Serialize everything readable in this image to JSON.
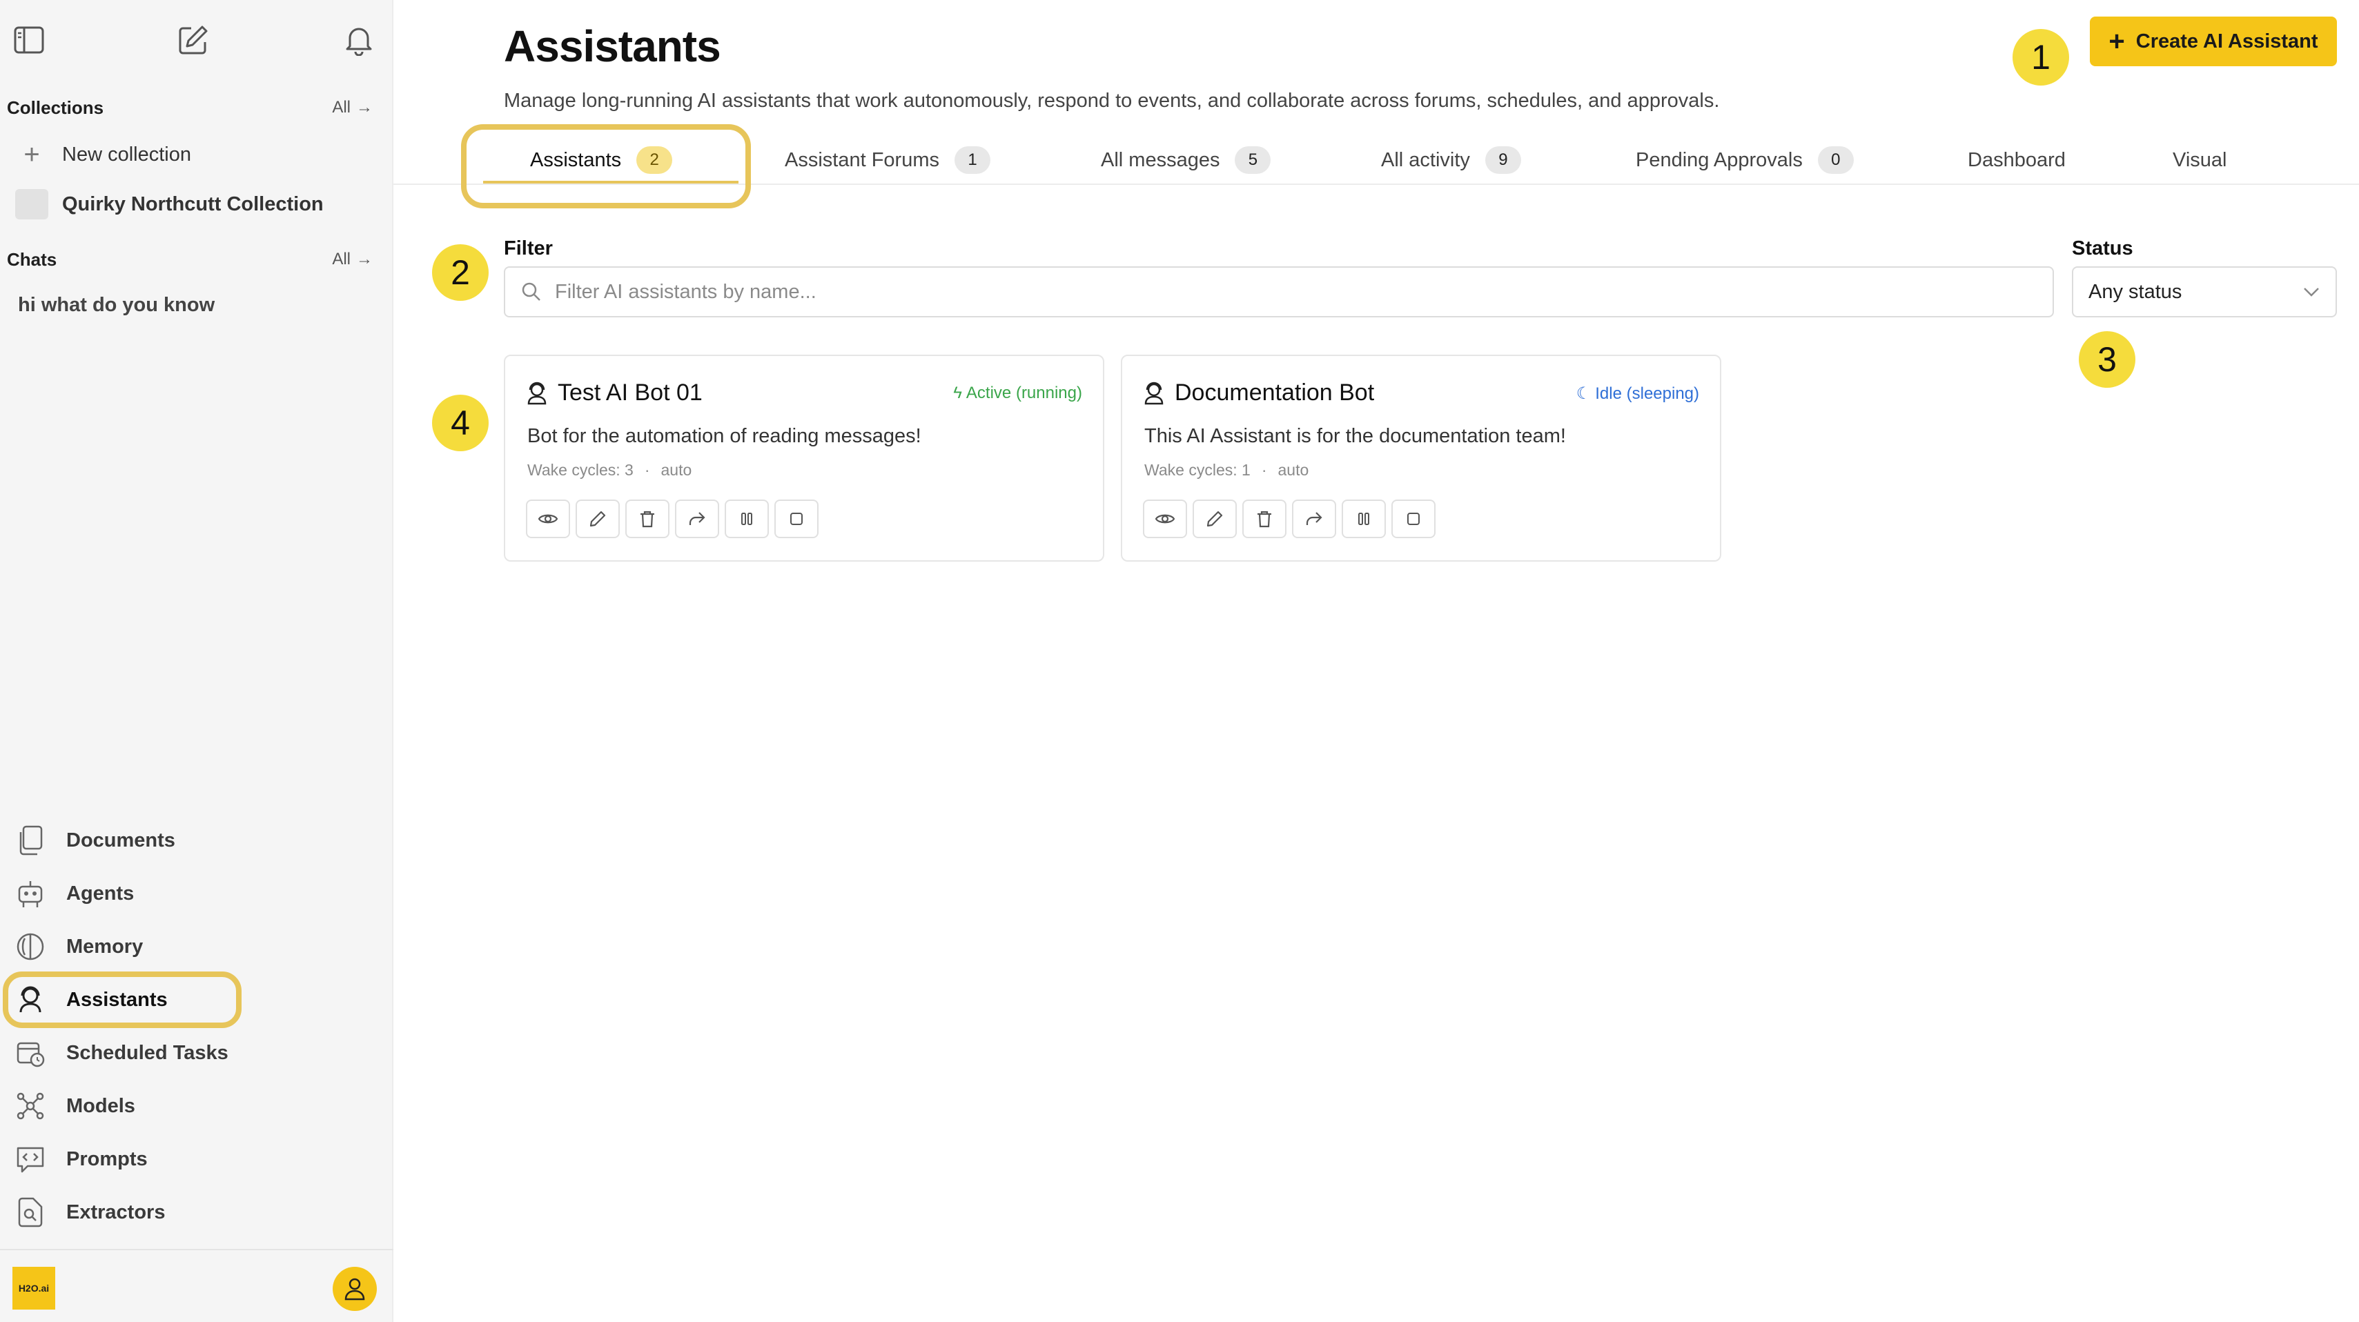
{
  "sidebar": {
    "collections_title": "Collections",
    "collections_all": "All",
    "new_collection": "New collection",
    "collection_item": "Quirky Northcutt Collection",
    "chats_title": "Chats",
    "chats_all": "All",
    "chat_item": "hi what do you know",
    "nav": [
      {
        "label": "Documents",
        "icon": "documents-icon"
      },
      {
        "label": "Agents",
        "icon": "robot-icon"
      },
      {
        "label": "Memory",
        "icon": "brain-icon"
      },
      {
        "label": "Assistants",
        "icon": "assistant-icon"
      },
      {
        "label": "Scheduled Tasks",
        "icon": "calendar-clock-icon"
      },
      {
        "label": "Models",
        "icon": "network-icon"
      },
      {
        "label": "Prompts",
        "icon": "code-chat-icon"
      },
      {
        "label": "Extractors",
        "icon": "file-search-icon"
      }
    ],
    "active_nav": "Assistants",
    "logo_text": "H2O.ai"
  },
  "header": {
    "title": "Assistants",
    "subtitle": "Manage long-running AI assistants that work autonomously, respond to events, and collaborate across forums, schedules, and approvals.",
    "create_button": "Create AI Assistant"
  },
  "tabs": [
    {
      "label": "Assistants",
      "count": "2"
    },
    {
      "label": "Assistant Forums",
      "count": "1"
    },
    {
      "label": "All messages",
      "count": "5"
    },
    {
      "label": "All activity",
      "count": "9"
    },
    {
      "label": "Pending Approvals",
      "count": "0"
    },
    {
      "label": "Dashboard",
      "count": ""
    },
    {
      "label": "Visual",
      "count": ""
    }
  ],
  "filter": {
    "label": "Filter",
    "placeholder": "Filter AI assistants by name...",
    "status_label": "Status",
    "status_value": "Any status"
  },
  "cards": [
    {
      "name": "Test AI Bot 01",
      "status": "Active (running)",
      "status_color": "#3aa54a",
      "description": "Bot for the automation of reading messages!",
      "wake_cycles": "Wake cycles: 3",
      "separator": "·",
      "mode": "auto"
    },
    {
      "name": "Documentation Bot",
      "status": "Idle (sleeping)",
      "status_color": "#2f6fd6",
      "description": "This AI Assistant is for the documentation team!",
      "wake_cycles": "Wake cycles: 1",
      "separator": "·",
      "mode": "auto"
    }
  ],
  "badges": [
    "1",
    "2",
    "3",
    "4"
  ],
  "colors": {
    "accent": "#f5c518",
    "highlight": "#e7c55a",
    "badge": "#f5dc3c"
  }
}
